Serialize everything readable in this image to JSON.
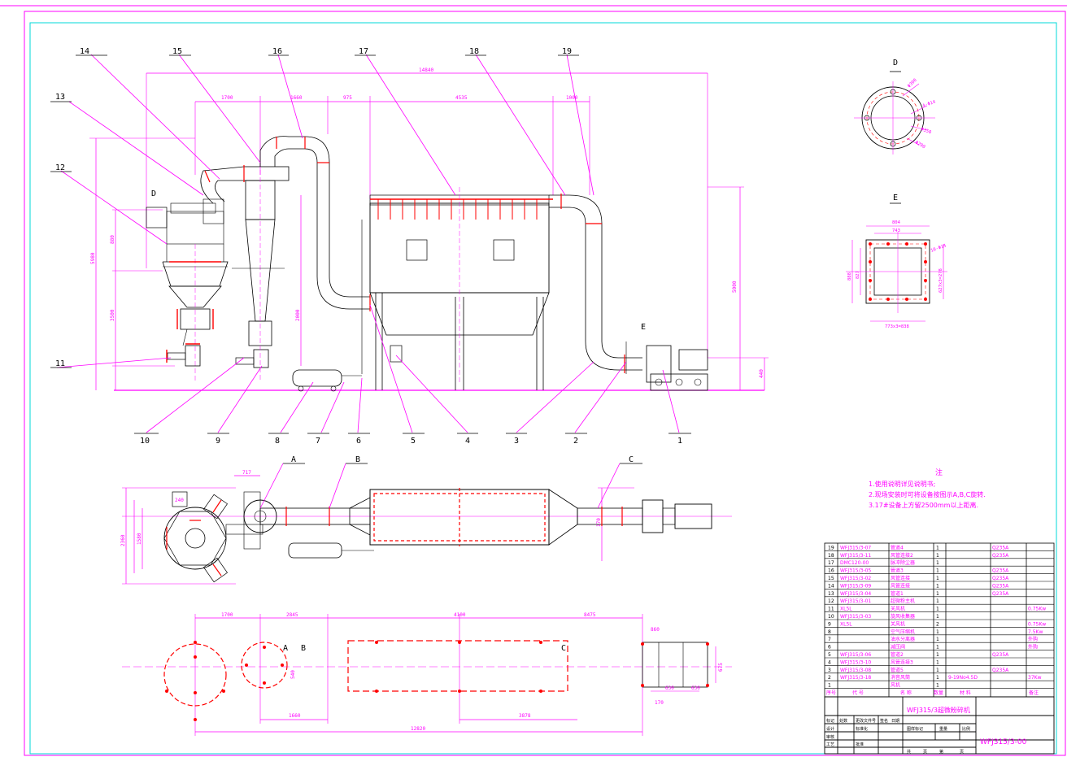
{
  "callouts": [
    "14",
    "15",
    "16",
    "17",
    "18",
    "19",
    "13",
    "12",
    "11",
    "10",
    "9",
    "8",
    "7",
    "6",
    "5",
    "4",
    "3",
    "2",
    "1"
  ],
  "view_letters": {
    "D": "D",
    "E": "E",
    "A": "A",
    "B": "B",
    "C": "C"
  },
  "dims_top": {
    "overall": "14840",
    "d1700": "1700",
    "d1660": "1660",
    "d975": "975",
    "d4535": "4535",
    "d1000": "1000",
    "h5000": "5000",
    "h440": "440",
    "h880": "880",
    "v5980": "5980",
    "v3500": "3500",
    "v2000": "2000"
  },
  "dims_plan": {
    "d717": "717",
    "d240": "240",
    "d2360": "2360",
    "d1580": "1580",
    "d170": "170"
  },
  "dims_bottom": {
    "d1700": "1700",
    "d2845": "2845",
    "d4100": "4100",
    "d8475": "8475",
    "d1660": "1660",
    "d3878": "3878",
    "d12820": "12820",
    "d540": "540",
    "d630a": "630",
    "d630b": "630",
    "d170": "170",
    "d675": "675",
    "d860": "860"
  },
  "view_D": {
    "label": "D",
    "dims": [
      "Φ390",
      "4-Φ14",
      "Φ350",
      "Φ290"
    ]
  },
  "view_E": {
    "label": "E",
    "dims": [
      "804",
      "743",
      "888",
      "827",
      "773x3=838",
      "10-Φ14",
      "627x3=2?8"
    ]
  },
  "notes": {
    "heading": "注",
    "lines": [
      "1.使用说明详见说明书;",
      "2.现场安装时可将设备按图示A,B,C旋转.",
      "3.17#设备上方留2500mm以上距离."
    ]
  },
  "bom": [
    {
      "no": "19",
      "code": "WFJ315/3-07",
      "name": "管道4",
      "qty": "1",
      "mat": "Q235A",
      "note": ""
    },
    {
      "no": "18",
      "code": "WFJ315/3-11",
      "name": "风管连接2",
      "qty": "1",
      "mat": "Q235A",
      "note": ""
    },
    {
      "no": "17",
      "code": "DMC120-00",
      "name": "脉冲除尘器",
      "qty": "1",
      "mat": "",
      "note": ""
    },
    {
      "no": "16",
      "code": "WFJ315/3-05",
      "name": "管道3",
      "qty": "1",
      "mat": "Q235A",
      "note": ""
    },
    {
      "no": "15",
      "code": "WFJ315/3-02",
      "name": "风管连接",
      "qty": "1",
      "mat": "Q235A",
      "note": ""
    },
    {
      "no": "14",
      "code": "WFJ315/3-09",
      "name": "风管连接",
      "qty": "1",
      "mat": "Q235A",
      "note": ""
    },
    {
      "no": "13",
      "code": "WFJ315/3-04",
      "name": "管道1",
      "qty": "1",
      "mat": "Q235A",
      "note": ""
    },
    {
      "no": "12",
      "code": "WFJ315/3-01",
      "name": "超微粉主机",
      "qty": "1",
      "mat": "",
      "note": ""
    },
    {
      "no": "11",
      "code": "XL5L",
      "name": "关风机",
      "qty": "1",
      "mat": "",
      "note": "0.75Kw"
    },
    {
      "no": "10",
      "code": "WFJ315/3-03",
      "name": "旋风收集器",
      "qty": "1",
      "mat": "",
      "note": ""
    },
    {
      "no": "9",
      "code": "XL5L",
      "name": "关风机",
      "qty": "2",
      "mat": "",
      "note": "0.75Kw"
    },
    {
      "no": "8",
      "code": "",
      "name": "空气压缩机",
      "qty": "1",
      "mat": "",
      "note": "7.5Kw"
    },
    {
      "no": "7",
      "code": "",
      "name": "油水分离器",
      "qty": "1",
      "mat": "",
      "note": "外购"
    },
    {
      "no": "6",
      "code": "",
      "name": "减压阀",
      "qty": "1",
      "mat": "",
      "note": "外购"
    },
    {
      "no": "5",
      "code": "WFJ315/3-06",
      "name": "管道2",
      "qty": "1",
      "mat": "Q235A",
      "note": ""
    },
    {
      "no": "4",
      "code": "WFJ315/3-10",
      "name": "风管连接3",
      "qty": "1",
      "mat": "",
      "note": ""
    },
    {
      "no": "3",
      "code": "WFJ315/3-08",
      "name": "管道5",
      "qty": "1",
      "mat": "Q235A",
      "note": ""
    },
    {
      "no": "2",
      "code": "WFJ315/3-18",
      "name": "消音风筒",
      "qty": "1",
      "mat": "9-19No4.5D",
      "note": "37Kw"
    },
    {
      "no": "1",
      "code": "",
      "name": "风机",
      "qty": "1",
      "mat": "",
      "note": ""
    }
  ],
  "bom_header": {
    "no": "序号",
    "code": "代 号",
    "name": "名 称",
    "qty": "数量",
    "mat": "材 料",
    "note": "备注"
  },
  "title_block": {
    "drawing_title": "WFJ315/3超微粉碎机",
    "drawing_no": "WFJ315/3-00",
    "labels": [
      "标记",
      "处数",
      "更改文件号",
      "签名",
      "日期",
      "设计",
      "标准化",
      "审核",
      "工艺",
      "批准",
      "图样标记",
      "重量",
      "比例",
      "共",
      "页",
      "第",
      "页"
    ]
  }
}
